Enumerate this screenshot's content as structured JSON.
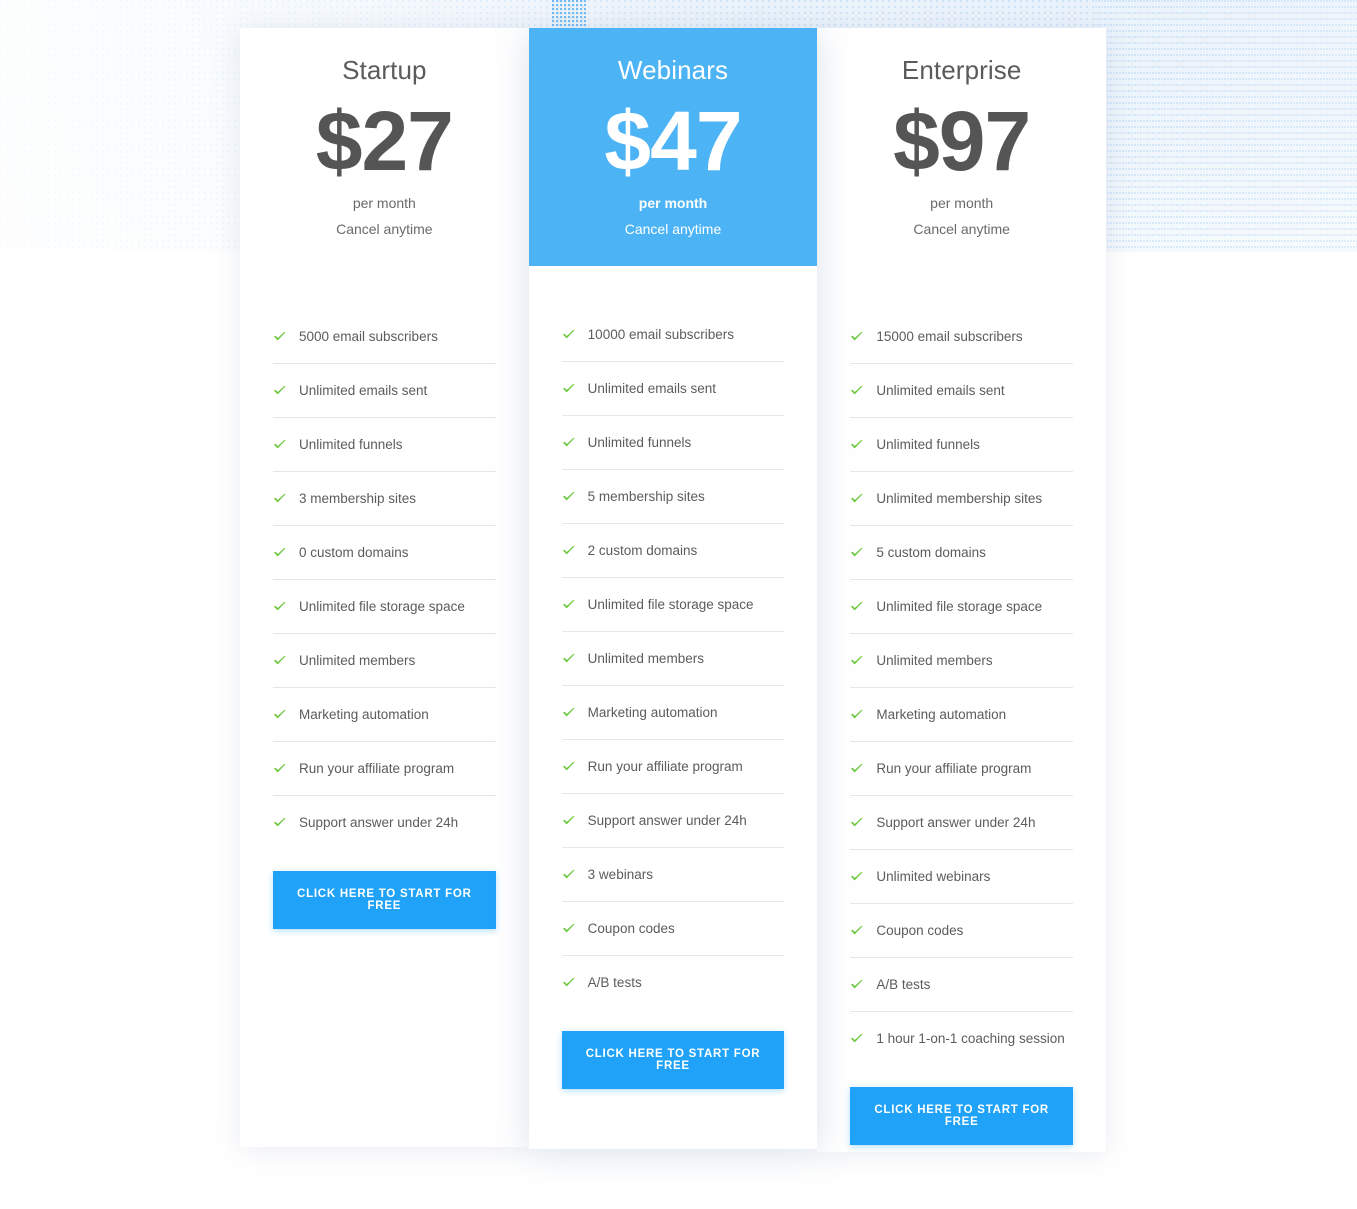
{
  "theme": {
    "accent_blue": "#4cb3f5",
    "button_blue": "#1fa2f8",
    "check_green": "#6cc83c",
    "text_gray": "#5c5c5c",
    "price_gray": "#555555",
    "divider_gray": "#e6e6e6",
    "background_band": "#eaf2fb"
  },
  "plans": [
    {
      "name": "Startup",
      "price": "$27",
      "period": "per month",
      "cancel_note": "Cancel anytime",
      "featured": false,
      "cta_label": "CLICK HERE TO START FOR FREE",
      "features": [
        "5000 email subscribers",
        "Unlimited emails sent",
        "Unlimited funnels",
        "3 membership sites",
        "0 custom domains",
        "Unlimited file storage space",
        "Unlimited members",
        "Marketing automation",
        "Run your affiliate program",
        "Support answer under 24h"
      ]
    },
    {
      "name": "Webinars",
      "price": "$47",
      "period": "per month",
      "cancel_note": "Cancel anytime",
      "featured": true,
      "cta_label": "CLICK HERE TO START FOR FREE",
      "features": [
        "10000 email subscribers",
        "Unlimited emails sent",
        "Unlimited funnels",
        "5 membership sites",
        "2 custom domains",
        "Unlimited file storage space",
        "Unlimited members",
        "Marketing automation",
        "Run your affiliate program",
        "Support answer under 24h",
        "3 webinars",
        "Coupon codes",
        "A/B tests"
      ]
    },
    {
      "name": "Enterprise",
      "price": "$97",
      "period": "per month",
      "cancel_note": "Cancel anytime",
      "featured": false,
      "cta_label": "CLICK HERE TO START FOR FREE",
      "features": [
        "15000 email subscribers",
        "Unlimited emails sent",
        "Unlimited funnels",
        "Unlimited membership sites",
        "5 custom domains",
        "Unlimited file storage space",
        "Unlimited members",
        "Marketing automation",
        "Run your affiliate program",
        "Support answer under 24h",
        "Unlimited webinars",
        "Coupon codes",
        "A/B tests",
        "1 hour 1-on-1 coaching session"
      ]
    }
  ],
  "icons": {
    "check": "check-icon"
  }
}
